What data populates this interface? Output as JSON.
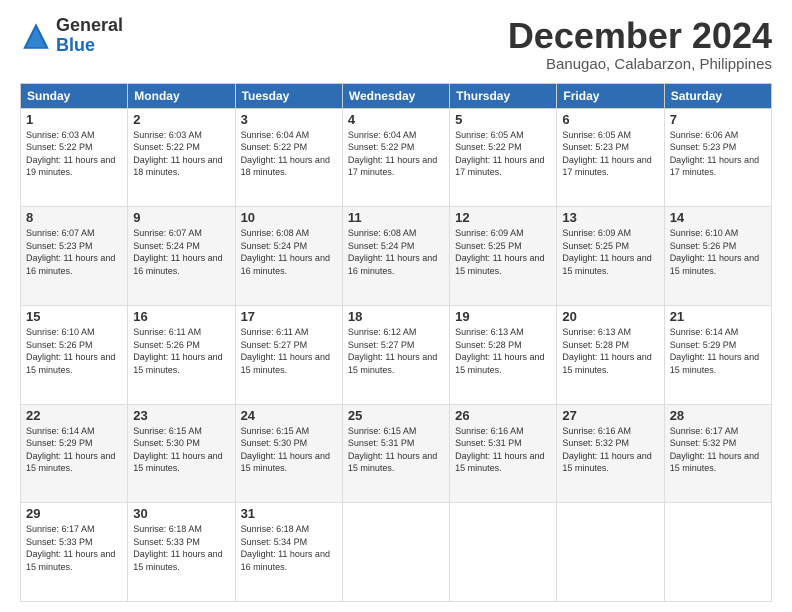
{
  "logo": {
    "general": "General",
    "blue": "Blue"
  },
  "title": "December 2024",
  "subtitle": "Banugao, Calabarzon, Philippines",
  "headers": [
    "Sunday",
    "Monday",
    "Tuesday",
    "Wednesday",
    "Thursday",
    "Friday",
    "Saturday"
  ],
  "weeks": [
    [
      {
        "day": "1",
        "sunrise": "6:03 AM",
        "sunset": "5:22 PM",
        "daylight": "11 hours and 19 minutes."
      },
      {
        "day": "2",
        "sunrise": "6:03 AM",
        "sunset": "5:22 PM",
        "daylight": "11 hours and 18 minutes."
      },
      {
        "day": "3",
        "sunrise": "6:04 AM",
        "sunset": "5:22 PM",
        "daylight": "11 hours and 18 minutes."
      },
      {
        "day": "4",
        "sunrise": "6:04 AM",
        "sunset": "5:22 PM",
        "daylight": "11 hours and 17 minutes."
      },
      {
        "day": "5",
        "sunrise": "6:05 AM",
        "sunset": "5:22 PM",
        "daylight": "11 hours and 17 minutes."
      },
      {
        "day": "6",
        "sunrise": "6:05 AM",
        "sunset": "5:23 PM",
        "daylight": "11 hours and 17 minutes."
      },
      {
        "day": "7",
        "sunrise": "6:06 AM",
        "sunset": "5:23 PM",
        "daylight": "11 hours and 17 minutes."
      }
    ],
    [
      {
        "day": "8",
        "sunrise": "6:07 AM",
        "sunset": "5:23 PM",
        "daylight": "11 hours and 16 minutes."
      },
      {
        "day": "9",
        "sunrise": "6:07 AM",
        "sunset": "5:24 PM",
        "daylight": "11 hours and 16 minutes."
      },
      {
        "day": "10",
        "sunrise": "6:08 AM",
        "sunset": "5:24 PM",
        "daylight": "11 hours and 16 minutes."
      },
      {
        "day": "11",
        "sunrise": "6:08 AM",
        "sunset": "5:24 PM",
        "daylight": "11 hours and 16 minutes."
      },
      {
        "day": "12",
        "sunrise": "6:09 AM",
        "sunset": "5:25 PM",
        "daylight": "11 hours and 15 minutes."
      },
      {
        "day": "13",
        "sunrise": "6:09 AM",
        "sunset": "5:25 PM",
        "daylight": "11 hours and 15 minutes."
      },
      {
        "day": "14",
        "sunrise": "6:10 AM",
        "sunset": "5:26 PM",
        "daylight": "11 hours and 15 minutes."
      }
    ],
    [
      {
        "day": "15",
        "sunrise": "6:10 AM",
        "sunset": "5:26 PM",
        "daylight": "11 hours and 15 minutes."
      },
      {
        "day": "16",
        "sunrise": "6:11 AM",
        "sunset": "5:26 PM",
        "daylight": "11 hours and 15 minutes."
      },
      {
        "day": "17",
        "sunrise": "6:11 AM",
        "sunset": "5:27 PM",
        "daylight": "11 hours and 15 minutes."
      },
      {
        "day": "18",
        "sunrise": "6:12 AM",
        "sunset": "5:27 PM",
        "daylight": "11 hours and 15 minutes."
      },
      {
        "day": "19",
        "sunrise": "6:13 AM",
        "sunset": "5:28 PM",
        "daylight": "11 hours and 15 minutes."
      },
      {
        "day": "20",
        "sunrise": "6:13 AM",
        "sunset": "5:28 PM",
        "daylight": "11 hours and 15 minutes."
      },
      {
        "day": "21",
        "sunrise": "6:14 AM",
        "sunset": "5:29 PM",
        "daylight": "11 hours and 15 minutes."
      }
    ],
    [
      {
        "day": "22",
        "sunrise": "6:14 AM",
        "sunset": "5:29 PM",
        "daylight": "11 hours and 15 minutes."
      },
      {
        "day": "23",
        "sunrise": "6:15 AM",
        "sunset": "5:30 PM",
        "daylight": "11 hours and 15 minutes."
      },
      {
        "day": "24",
        "sunrise": "6:15 AM",
        "sunset": "5:30 PM",
        "daylight": "11 hours and 15 minutes."
      },
      {
        "day": "25",
        "sunrise": "6:15 AM",
        "sunset": "5:31 PM",
        "daylight": "11 hours and 15 minutes."
      },
      {
        "day": "26",
        "sunrise": "6:16 AM",
        "sunset": "5:31 PM",
        "daylight": "11 hours and 15 minutes."
      },
      {
        "day": "27",
        "sunrise": "6:16 AM",
        "sunset": "5:32 PM",
        "daylight": "11 hours and 15 minutes."
      },
      {
        "day": "28",
        "sunrise": "6:17 AM",
        "sunset": "5:32 PM",
        "daylight": "11 hours and 15 minutes."
      }
    ],
    [
      {
        "day": "29",
        "sunrise": "6:17 AM",
        "sunset": "5:33 PM",
        "daylight": "11 hours and 15 minutes."
      },
      {
        "day": "30",
        "sunrise": "6:18 AM",
        "sunset": "5:33 PM",
        "daylight": "11 hours and 15 minutes."
      },
      {
        "day": "31",
        "sunrise": "6:18 AM",
        "sunset": "5:34 PM",
        "daylight": "11 hours and 16 minutes."
      },
      null,
      null,
      null,
      null
    ]
  ]
}
